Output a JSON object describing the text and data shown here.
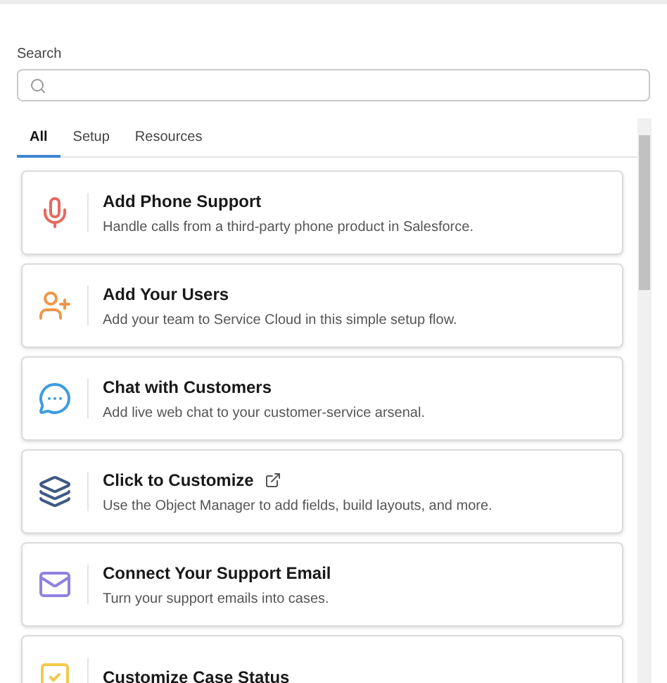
{
  "search": {
    "label": "Search"
  },
  "tabs": [
    {
      "label": "All",
      "selected": true
    },
    {
      "label": "Setup",
      "selected": false
    },
    {
      "label": "Resources",
      "selected": false
    }
  ],
  "cards": [
    {
      "kind": "mic",
      "title": "Add Phone Support",
      "description": "Handle calls from a third-party phone product in Salesforce.",
      "external": false
    },
    {
      "kind": "user-add",
      "title": "Add Your Users",
      "description": "Add your team to Service Cloud in this simple setup flow.",
      "external": false
    },
    {
      "kind": "chat",
      "title": "Chat with Customers",
      "description": "Add live web chat to your customer-service arsenal.",
      "external": false
    },
    {
      "kind": "layers",
      "title": "Click to Customize",
      "description": "Use the Object Manager to add fields, build layouts, and more.",
      "external": true
    },
    {
      "kind": "mail",
      "title": "Connect Your Support Email",
      "description": "Turn your support emails into cases.",
      "external": false
    },
    {
      "kind": "status",
      "title": "Customize Case Status",
      "external": false
    }
  ]
}
